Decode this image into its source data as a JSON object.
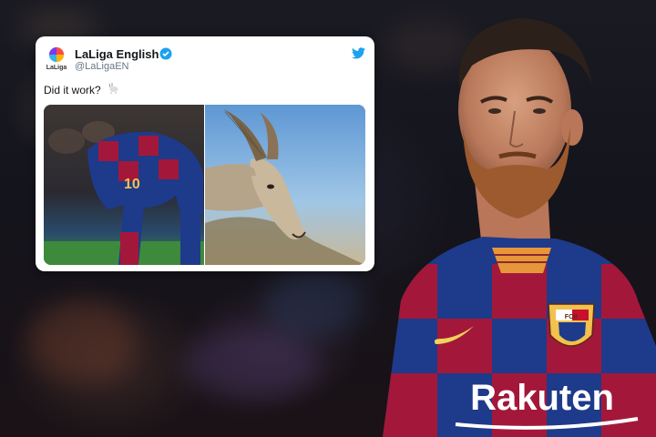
{
  "tweet": {
    "avatar_text": "LaLiga",
    "display_name": "LaLiga English",
    "handle": "@LaLigaEN",
    "text": "Did it work?",
    "emoji_name": "goat-emoji"
  },
  "left_photo": {
    "shirt_number": "10"
  },
  "player": {
    "sponsor": "Rakuten",
    "crest_letters": "FCB"
  },
  "colors": {
    "barca_blue": "#1e3a8a",
    "barca_red": "#a3183a",
    "twitter_blue": "#1da1f2",
    "verified_blue": "#1da1f2"
  }
}
